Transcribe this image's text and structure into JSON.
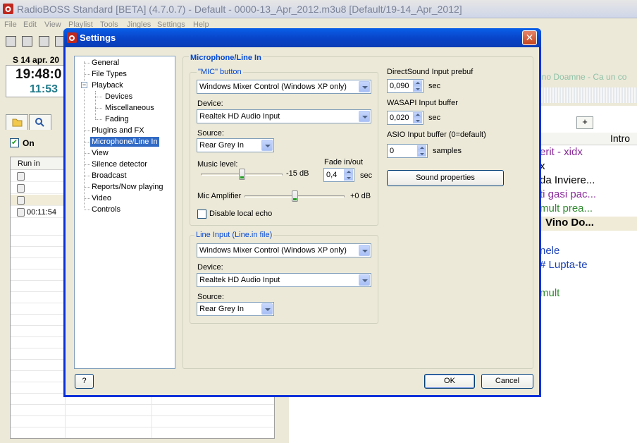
{
  "main_window": {
    "title": "RadioBOSS Standard [BETA] (4.7.0.7) - Default - 0000-13_Apr_2012.m3u8 [Default/19-14_Apr_2012]",
    "menu": [
      "File",
      "Edit",
      "View",
      "Playlist",
      "Tools",
      "Jingles",
      "Settings",
      "Help"
    ],
    "clock": {
      "date": "S 14 apr. 20",
      "time": "19:48:0",
      "remaining": "11:53"
    },
    "on_label": "On",
    "left_list": {
      "column_header": "Run in",
      "row_time": "00:11:54"
    },
    "now_playing_strip": "ino Doamne - Ca un co",
    "playlist_header": "Intro",
    "playlist_rows": [
      {
        "text": "erit - xidx",
        "color": "#8a2b9a"
      },
      {
        "text": "x",
        "color": "#000000"
      },
      {
        "text": "da Inviere...",
        "color": "#000000"
      },
      {
        "text": "ti gasi pac...",
        "color": "#8a2b9a"
      },
      {
        "text": "mult prea...",
        "color": "#2f8a2f"
      },
      {
        "text": "Vino Do...",
        "color": "#000000"
      },
      {
        "text": "",
        "color": "#000000"
      },
      {
        "text": "nele",
        "color": "#1a3fb5"
      },
      {
        "text": "# Lupta-te",
        "color": "#1a3fb5"
      },
      {
        "text": "",
        "color": "#000000"
      },
      {
        "text": "mult",
        "color": "#2f8a2f"
      }
    ]
  },
  "dialog": {
    "title": "Settings",
    "close_glyph": "✕",
    "tree": [
      {
        "label": "General",
        "level": 0
      },
      {
        "label": "File Types",
        "level": 0
      },
      {
        "label": "Playback",
        "level": 0,
        "expander": "−"
      },
      {
        "label": "Devices",
        "level": 1
      },
      {
        "label": "Miscellaneous",
        "level": 1
      },
      {
        "label": "Fading",
        "level": 1
      },
      {
        "label": "Plugins and FX",
        "level": 0
      },
      {
        "label": "Microphone/Line In",
        "level": 0,
        "selected": true
      },
      {
        "label": "View",
        "level": 0
      },
      {
        "label": "Silence detector",
        "level": 0
      },
      {
        "label": "Broadcast",
        "level": 0
      },
      {
        "label": "Reports/Now playing",
        "level": 0
      },
      {
        "label": "Video",
        "level": 0
      },
      {
        "label": "Controls",
        "level": 0
      }
    ],
    "page_title": "Microphone/Line In",
    "mic_group": {
      "title": "\"MIC\" button",
      "mixer_value": "Windows Mixer Control (Windows XP only)",
      "device_label": "Device:",
      "device_value": "Realtek HD Audio Input",
      "source_label": "Source:",
      "source_value": "Rear Grey In",
      "music_level_label": "Music level:",
      "music_level_value": "-15 dB",
      "music_level_fraction": 0.5,
      "fade_label": "Fade in/out",
      "fade_value": "0,4",
      "fade_unit": "sec",
      "mic_amp_label": "Mic Amplifier",
      "mic_amp_value": "+0 dB",
      "mic_amp_fraction": 0.5,
      "disable_echo_label": "Disable local echo",
      "disable_echo_checked": false
    },
    "line_group": {
      "title": "Line Input (Line.in file)",
      "mixer_value": "Windows Mixer Control (Windows XP only)",
      "device_label": "Device:",
      "device_value": "Realtek HD Audio Input",
      "source_label": "Source:",
      "source_value": "Rear Grey In"
    },
    "buffers": {
      "directsound_label": "DirectSound Input prebuf",
      "directsound_value": "0,090",
      "directsound_unit": "sec",
      "wasapi_label": "WASAPI Input buffer",
      "wasapi_value": "0,020",
      "wasapi_unit": "sec",
      "asio_label": "ASIO Input buffer (0=default)",
      "asio_value": "0",
      "asio_unit": "samples",
      "sound_properties_label": "Sound properties"
    },
    "buttons": {
      "help": "?",
      "ok": "OK",
      "cancel": "Cancel"
    }
  }
}
